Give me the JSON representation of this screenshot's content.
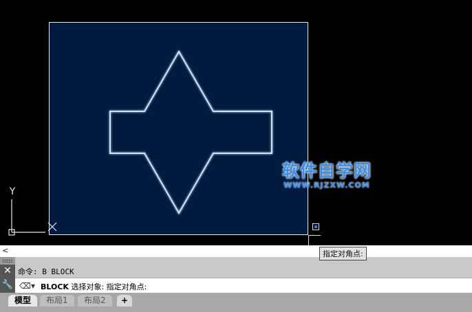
{
  "canvas": {
    "background": "#000000",
    "selection_fill": "#001a40",
    "shape_stroke": "#cfe3ff",
    "ucs_y_label": "Y",
    "ucs_x_label": "X"
  },
  "watermark": {
    "title": "软件自学网",
    "url": "WWW.RJZXW.COM",
    "color": "#3f8fe8"
  },
  "tooltip": {
    "text": "指定对角点:"
  },
  "scrollbar": {
    "left_arrow": "<"
  },
  "command_panel": {
    "history_line": "命令: B BLOCK",
    "close_label": "✕",
    "config_icon": "wrench-icon",
    "prompt_icon": "command-prompt-icon",
    "input_command": "BLOCK",
    "input_prompt": "选择对象: 指定对角点:"
  },
  "tabs": {
    "model": "模型",
    "layout1": "布局1",
    "layout2": "布局2",
    "add": "+"
  }
}
